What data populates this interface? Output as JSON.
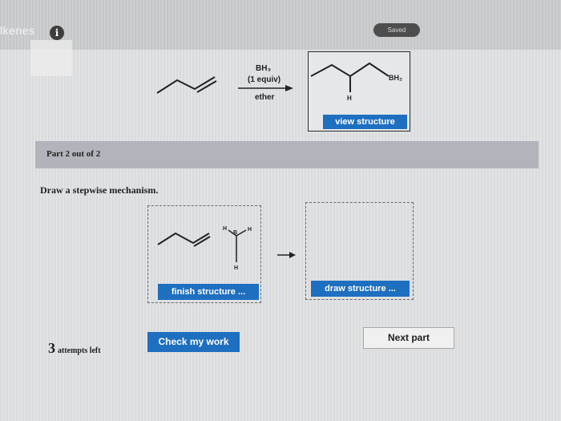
{
  "header": {
    "title": "lkenes",
    "info_icon": "i",
    "saved_badge": "Saved"
  },
  "reaction": {
    "reagent_line1": "BH₃",
    "reagent_line2": "(1 equiv)",
    "solvent": "ether",
    "product_group": "BH₂",
    "product_h": "H",
    "view_button": "view structure"
  },
  "part": {
    "label": "Part 2 out of 2",
    "instructions": "Draw a stepwise mechanism."
  },
  "mechanism": {
    "box1_button": "finish structure ...",
    "box2_button": "draw structure ...",
    "box1_labels": {
      "h_left": "H",
      "b": "B",
      "h_right": "H",
      "h_bottom": "H"
    }
  },
  "footer": {
    "attempts_count": "3",
    "attempts_label": "attempts left",
    "check_button": "Check my work",
    "next_button": "Next part"
  },
  "colors": {
    "primary_button": "#1e6fbf",
    "banner": "#b2b3bb",
    "saved_badge": "#4d4d4d"
  }
}
